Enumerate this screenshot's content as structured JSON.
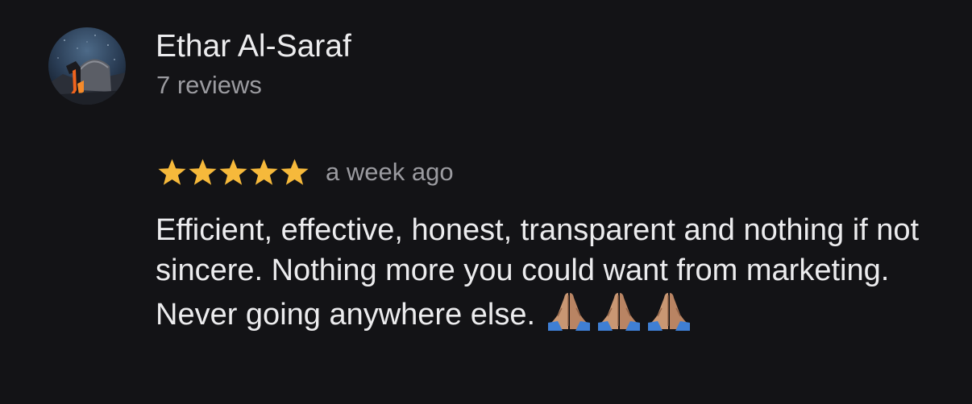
{
  "reviewer": {
    "name": "Ethar Al-Saraf",
    "review_count": "7 reviews",
    "avatar_icon": "observatory-dome-avatar"
  },
  "review": {
    "rating": 5,
    "rating_max": 5,
    "time_ago": "a week ago",
    "text": "Efficient, effective, honest, transparent and nothing if not sincere. Nothing more you could want from marketing. Never going anywhere else.",
    "emojis": [
      "folded-hands-emoji",
      "folded-hands-emoji",
      "folded-hands-emoji"
    ]
  },
  "colors": {
    "background": "#131316",
    "primary_text": "#ececee",
    "secondary_text": "#9b9ba0",
    "star": "#f6b93b"
  }
}
